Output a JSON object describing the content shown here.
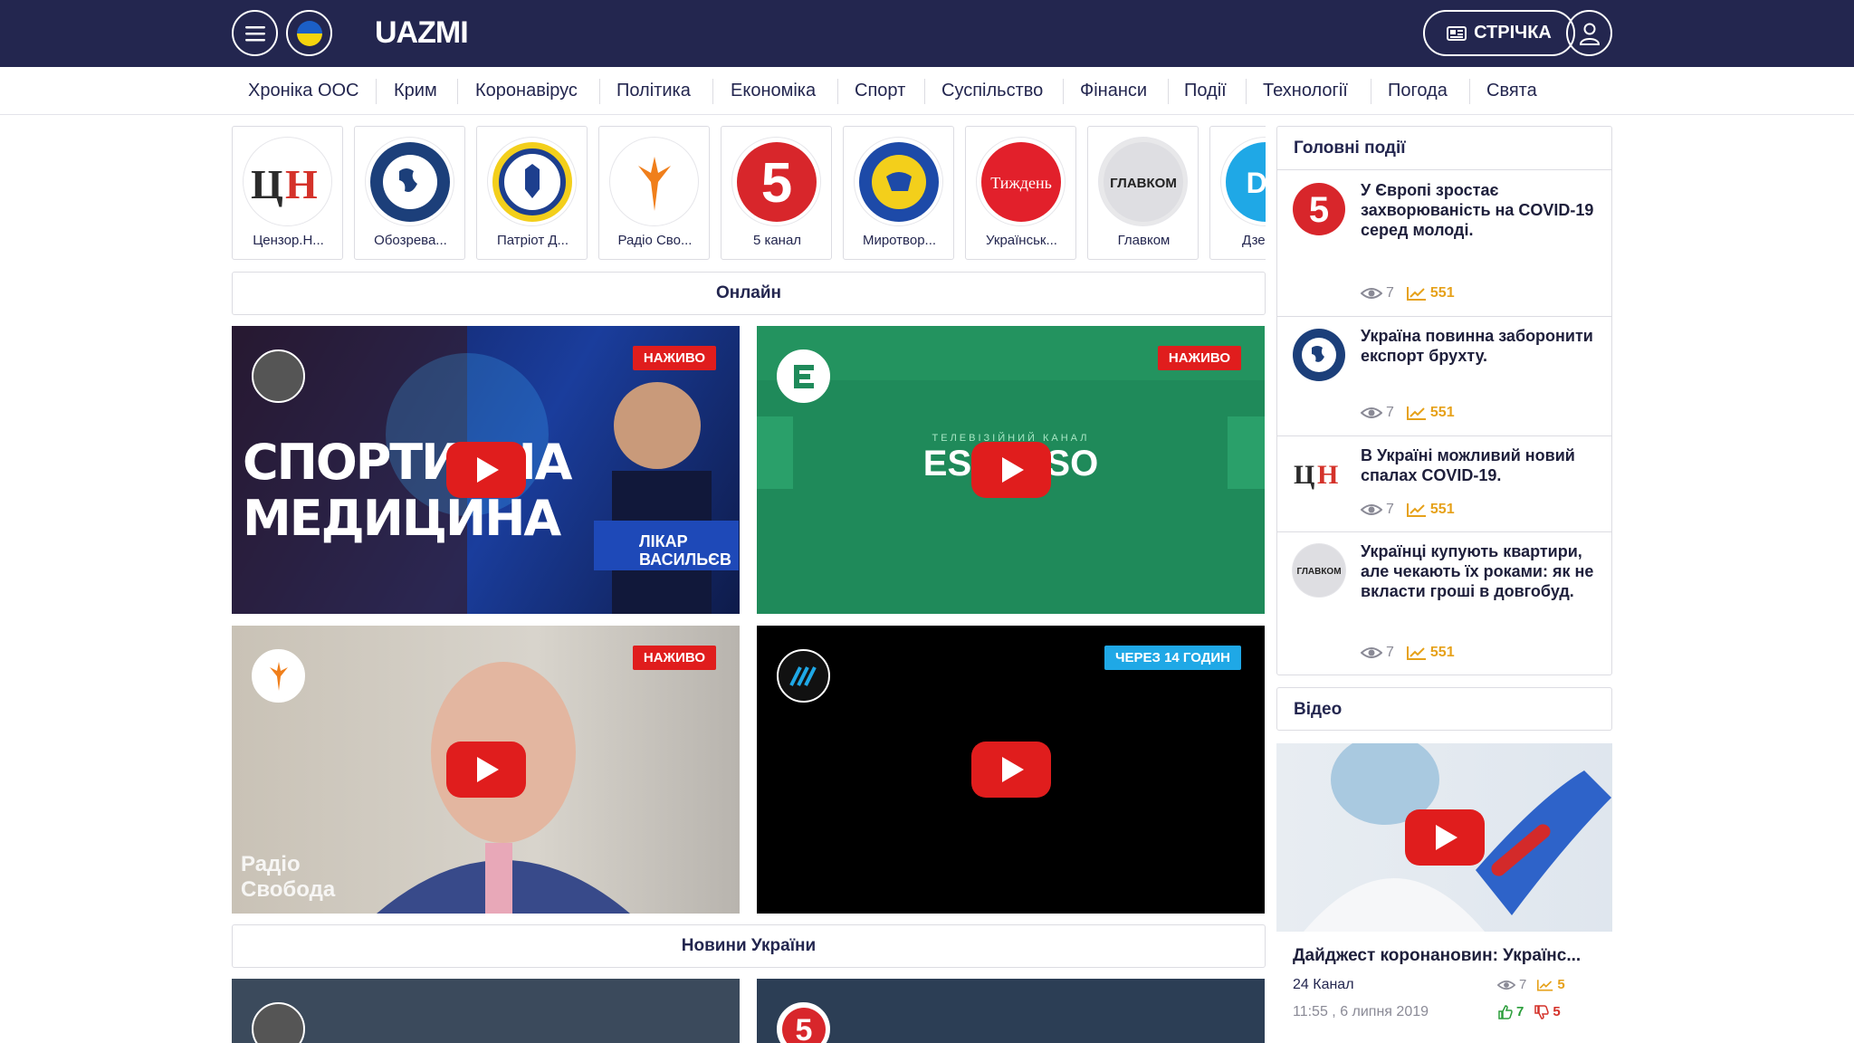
{
  "header": {
    "logo": "UAZMI",
    "feed_label": "СТРІЧКА",
    "menu_icon": "hamburger-icon",
    "flag_icon": "ukraine-flag-icon",
    "user_icon": "user-icon"
  },
  "categories": [
    "Хроніка ООС",
    "Крим",
    "Коронавірус",
    "Політика",
    "Економіка",
    "Спорт",
    "Суспільство",
    "Фінанси",
    "Події",
    "Технології",
    "Погода",
    "Свята"
  ],
  "sources": [
    {
      "name": "Цензор.Н...",
      "logo": "ЦН"
    },
    {
      "name": "Обозрева...",
      "logo": "globe"
    },
    {
      "name": "Патріот Д...",
      "logo": "patriot"
    },
    {
      "name": "Радіо Сво...",
      "logo": "torch"
    },
    {
      "name": "5 канал",
      "logo": "5"
    },
    {
      "name": "Миротвор...",
      "logo": "myrotvorets"
    },
    {
      "name": "Українськ...",
      "logo": "Тиждень"
    },
    {
      "name": "Главком",
      "logo": "ГЛАВКОМ"
    },
    {
      "name": "Дзерк...",
      "logo": "DT"
    }
  ],
  "online": {
    "title": "Онлайн",
    "videos": [
      {
        "badge": "НАЖИВО",
        "badge_color": "#e01d1d",
        "headline": "СПОРТИВНА МЕДИЦИНА",
        "caption": "ЛІКАР ВАСИЛЬЄВ"
      },
      {
        "badge": "НАЖИВО",
        "badge_color": "#e01d1d",
        "headline": "ТЕЛЕВІЗІЙНИЙ КАНАЛ",
        "caption": "ESPRESO"
      },
      {
        "badge": "НАЖИВО",
        "badge_color": "#e01d1d",
        "caption": "Радіо Свобода"
      },
      {
        "badge": "ЧЕРЕЗ 14 ГОДИН",
        "badge_color": "#1fa8e6"
      }
    ]
  },
  "news_ukraine": {
    "title": "Новини України"
  },
  "top_events": {
    "title": "Головні події",
    "items": [
      {
        "logo": "5",
        "title": "У Європі зростає захворюваність на COVID-19 серед молоді.",
        "views": "7",
        "trend": "551"
      },
      {
        "logo": "globe",
        "title": "Україна повинна заборонити експорт брухту.",
        "views": "7",
        "trend": "551"
      },
      {
        "logo": "ЦН",
        "title": "В Україні можливий новий спалах COVID-19.",
        "views": "7",
        "trend": "551"
      },
      {
        "logo": "ГЛАВКОМ",
        "title": "Українці купують квартири, але чекають їх роками: як не вкласти гроші в довгобуд.",
        "views": "7",
        "trend": "551"
      }
    ]
  },
  "video_panel": {
    "title": "Відео",
    "item": {
      "title": "Дайджест коронановин: Українс...",
      "source": "24 Канал",
      "date": "11:55 , 6 липня 2019",
      "views": "7",
      "trend": "5",
      "likes": "7",
      "dislikes": "5"
    }
  },
  "colors": {
    "header_bg": "#23264f",
    "live": "#e01d1d",
    "scheduled": "#1fa8e6",
    "trend": "#e6a11a",
    "like": "#2a9d3a",
    "dislike": "#d4322a"
  }
}
